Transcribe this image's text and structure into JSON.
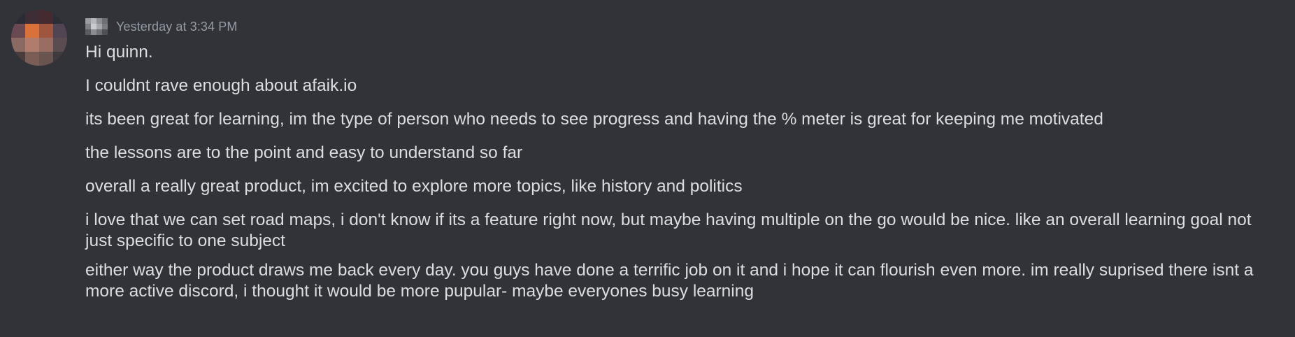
{
  "message": {
    "avatar": {
      "pixels": [
        "#2a2c35",
        "#3d2e36",
        "#452a30",
        "#2c2e36",
        "#6a4a52",
        "#d8713a",
        "#a0553f",
        "#514553",
        "#8a6a62",
        "#b07c6c",
        "#9a6d62",
        "#5a4c50",
        "#4b3c3e",
        "#7a5e56",
        "#6a5450",
        "#3e3a3e"
      ]
    },
    "username_blur": [
      "#9a9ca2",
      "#b5b7bd",
      "#8d8f95",
      "#6d6f75",
      "#7d7f85",
      "#c8cacf",
      "#a5a7ad",
      "#7b7d83",
      "#5a5c62",
      "#8a8c92",
      "#6f7177",
      "#4e5056"
    ],
    "timestamp": "Yesterday at 3:34 PM",
    "lines": [
      "Hi quinn.",
      "I couldnt rave enough about afaik.io",
      "its been great for learning, im the type of person who needs to see progress and having the % meter is great for keeping me motivated",
      "the lessons are to the point and easy to understand so far",
      "overall a really great product, im excited to explore more topics, like history and politics",
      "i love that we can set road maps, i don't know if its a feature right now, but maybe having multiple on the go would be nice. like an overall learning goal not just specific to one subject",
      "either way the product draws me back every day. you guys have done a terrific job on it and i hope it can flourish even more. im really suprised there isnt a more active discord, i thought it would be more pupular- maybe everyones busy learning"
    ]
  }
}
